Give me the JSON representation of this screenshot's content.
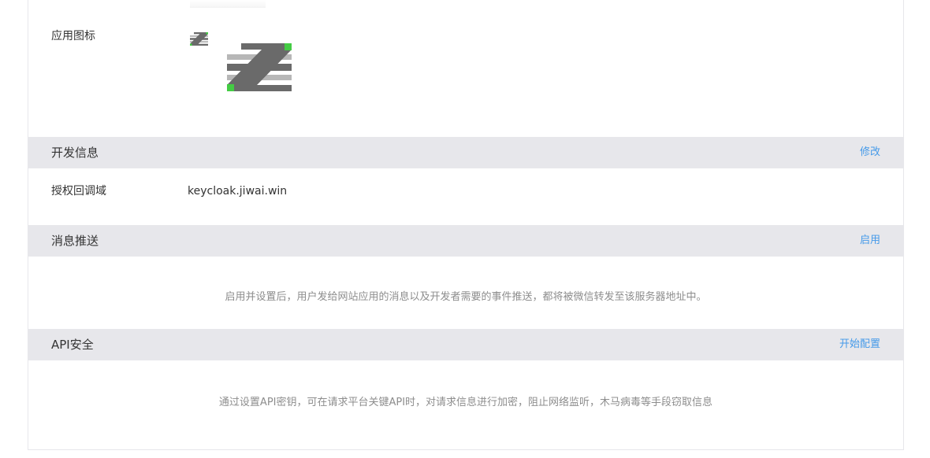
{
  "app_icon": {
    "label": "应用图标",
    "icon_name": "zhe-logo-icon",
    "colors": {
      "dark": "#6a6a6a",
      "light": "#b7b7b7",
      "accent": "#44cc44"
    }
  },
  "dev_info": {
    "title": "开发信息",
    "action": "修改",
    "callback_label": "授权回调域",
    "callback_value": "keycloak.jiwai.win"
  },
  "message_push": {
    "title": "消息推送",
    "action": "启用",
    "hint": "启用并设置后，用户发给网站应用的消息以及开发者需要的事件推送，都将被微信转发至该服务器地址中。"
  },
  "api_security": {
    "title": "API安全",
    "action": "开始配置",
    "hint": "通过设置API密钥，可在请求平台关键API时，对请求信息进行加密，阻止网络监听，木马病毒等手段窃取信息"
  },
  "colors": {
    "link": "#459ae9",
    "section_bg": "#e7e7eb",
    "hint_text": "#8d8d8d"
  }
}
